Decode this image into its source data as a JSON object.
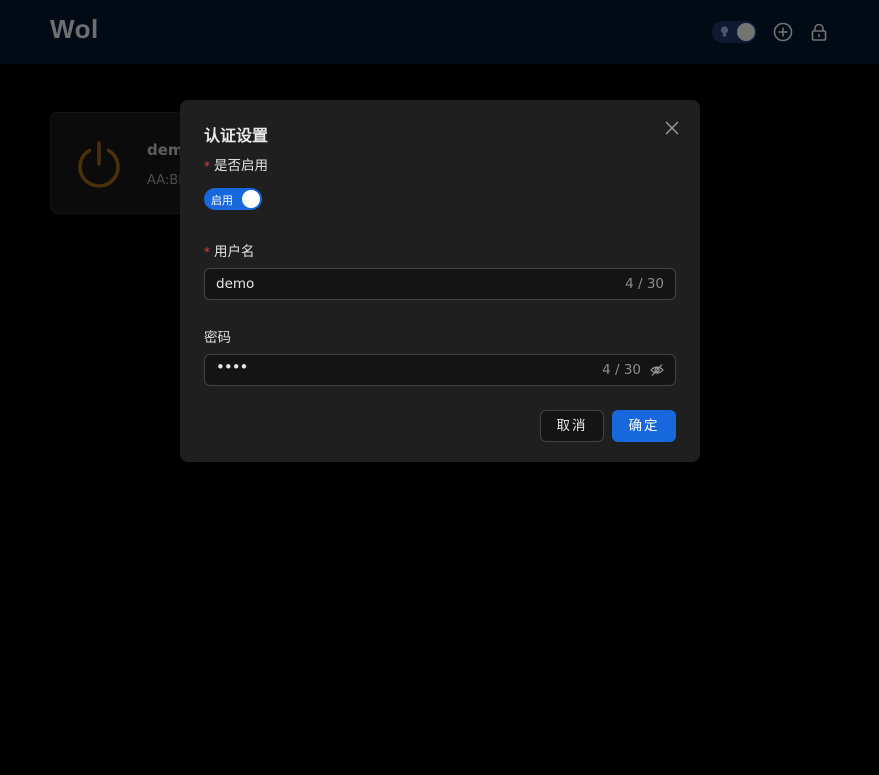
{
  "app": {
    "title": "Wol"
  },
  "header": {
    "theme_toggle_icon": "bulb-icon",
    "add_icon": "plus-circle-icon",
    "lock_icon": "lock-icon"
  },
  "devices": [
    {
      "name": "demo",
      "mac": "AA:BB:CC:DD:EE:FF",
      "icon": "power-icon",
      "icon_color": "#8b5a10"
    }
  ],
  "modal": {
    "title": "认证设置",
    "enable_field": {
      "required_mark": "*",
      "label": "是否启用",
      "switch_text": "启用",
      "checked": true
    },
    "username_field": {
      "required_mark": "*",
      "label": "用户名",
      "value": "demo",
      "count": "4 / 30"
    },
    "password_field": {
      "label": "密码",
      "masked_value": "••••",
      "count": "4 / 30",
      "icon": "eye-invisible-icon"
    },
    "cancel_label": "取消",
    "ok_label": "确定"
  },
  "colors": {
    "header_bg": "#001529",
    "primary": "#1668dc",
    "required": "#dc4446",
    "modal_bg": "#1f1f1f"
  }
}
